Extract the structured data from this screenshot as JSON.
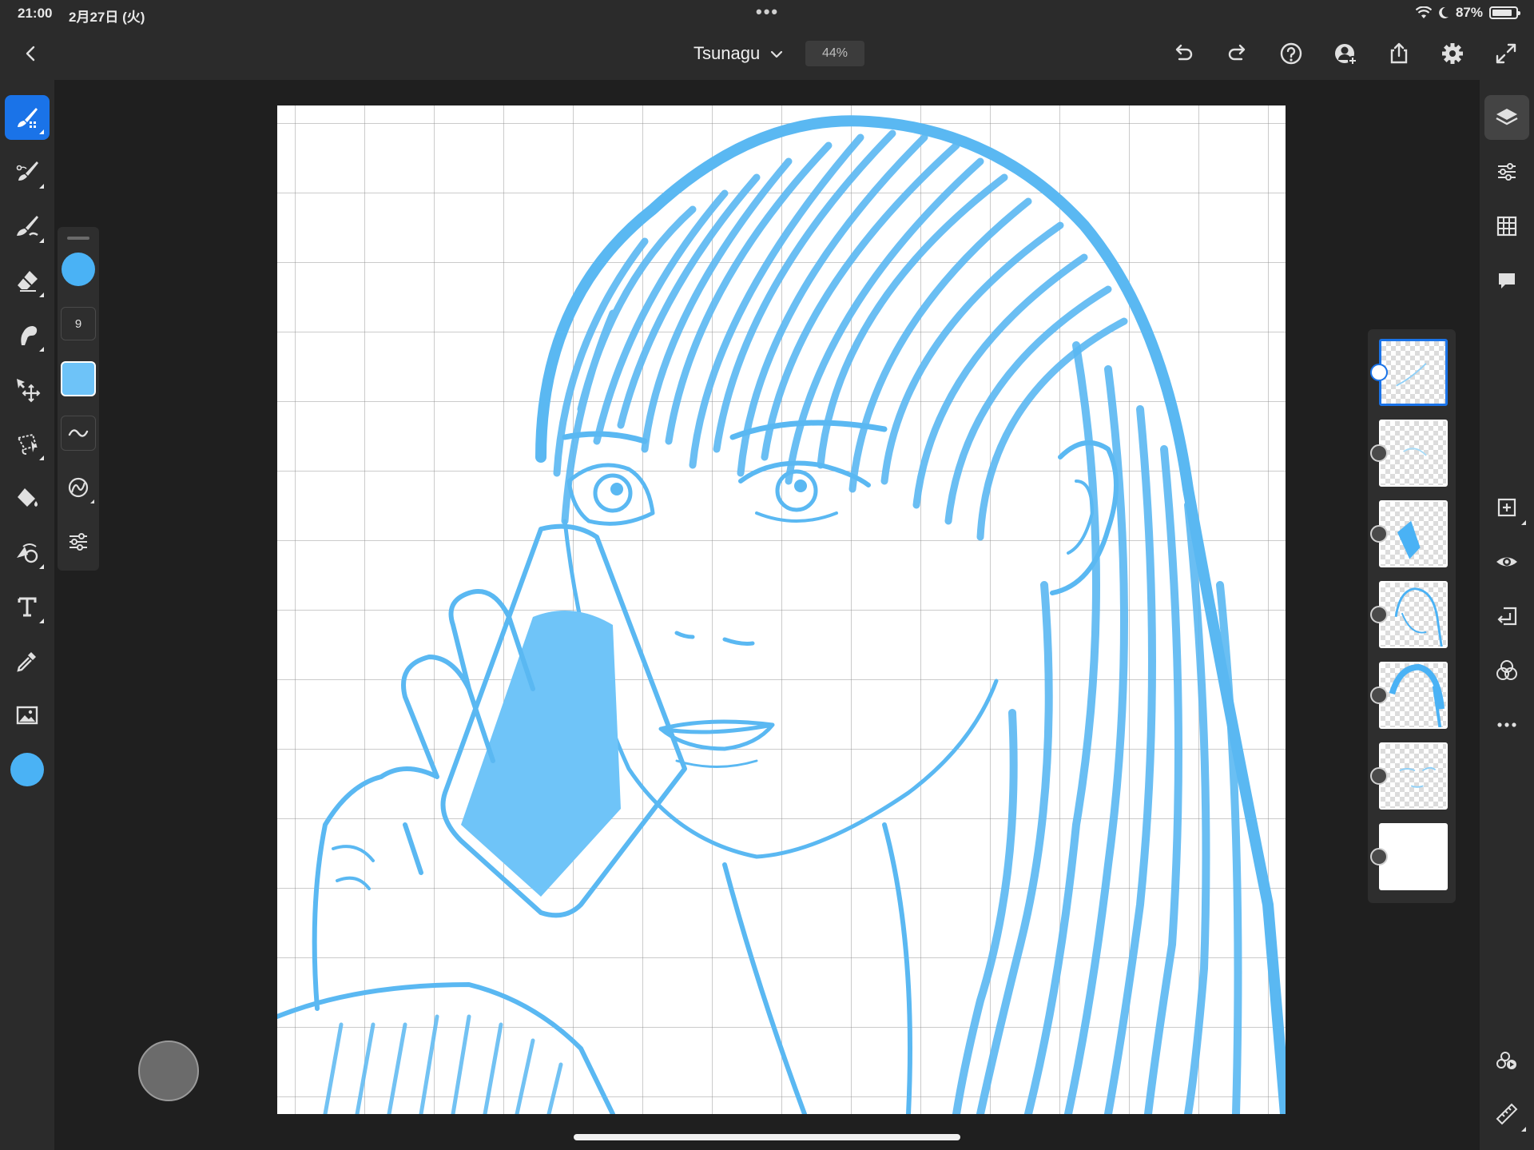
{
  "status_bar": {
    "time": "21:00",
    "date": "2月27日 (火)",
    "battery": "87%",
    "battery_level": 0.87,
    "wifi_icon": "wifi-icon",
    "moon_icon": "do-not-disturb-icon"
  },
  "top_bar": {
    "document_title": "Tsunagu",
    "zoom": "44%",
    "icons": [
      "back-icon",
      "chevron-down-icon",
      "undo-icon",
      "redo-icon",
      "help-icon",
      "share-user-icon",
      "export-icon",
      "settings-gear-icon",
      "fullscreen-icon"
    ]
  },
  "left_toolbar": {
    "tools": [
      "pixel-brush-icon",
      "vector-brush-icon",
      "fill-brush-icon",
      "eraser-icon",
      "smudge-icon",
      "move-transform-icon",
      "lasso-select-icon",
      "paint-bucket-icon",
      "liquify-icon",
      "text-tool-icon",
      "eyedropper-icon",
      "image-place-icon"
    ],
    "active_tool": "pixel-brush-icon",
    "current_color": "#4ab2f5"
  },
  "brush_panel": {
    "size": "9",
    "color": "#4ab2f5",
    "swatch_color": "#6ec3f8",
    "items": [
      "smoothing-icon",
      "predictive-stroke-icon",
      "brush-settings-icon"
    ]
  },
  "canvas": {
    "line_color": "#5ab8f2",
    "fill_color": "#6fc4f8"
  },
  "layers": {
    "count": 7,
    "selected_index": 0
  },
  "right_toolbar": {
    "tools": [
      "layers-icon",
      "layer-properties-icon",
      "grid-icon",
      "comments-icon",
      "add-layer-icon",
      "visibility-eye-icon",
      "import-layer-icon",
      "blend-mode-icon",
      "more-icon",
      "timelapse-icon",
      "ruler-icon"
    ],
    "active_tool": "layers-icon"
  }
}
